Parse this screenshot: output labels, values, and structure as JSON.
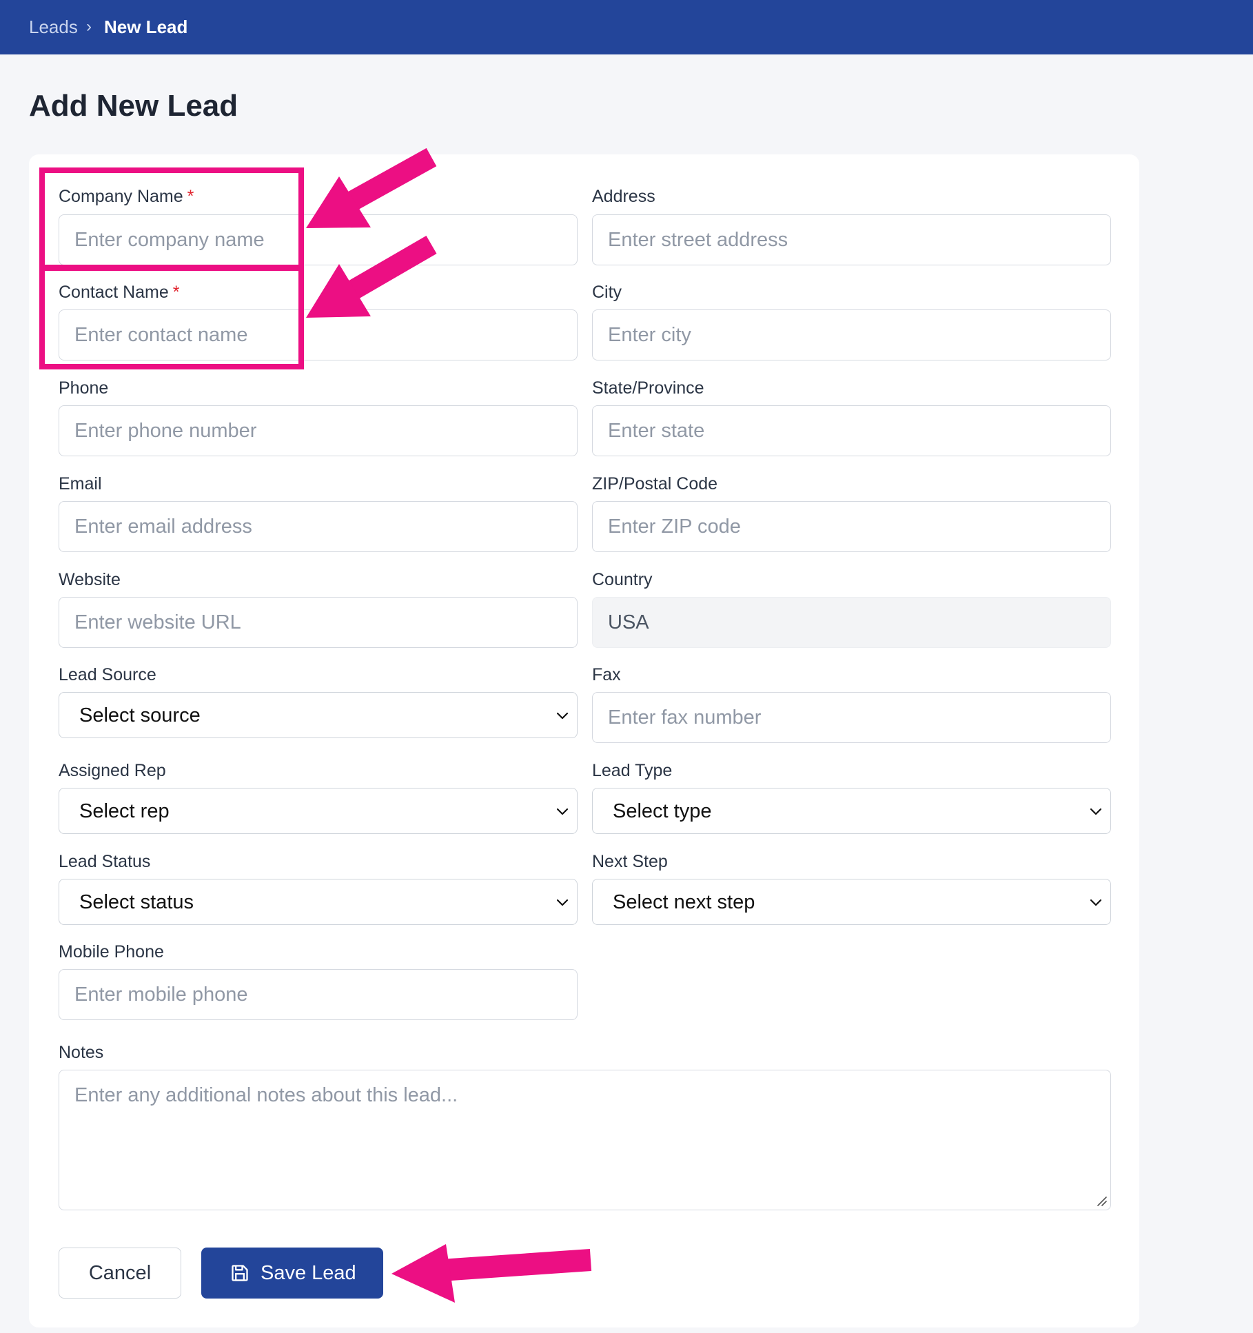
{
  "breadcrumb": {
    "parent": "Leads",
    "separator": "›",
    "current": "New Lead"
  },
  "page": {
    "title": "Add New Lead"
  },
  "form": {
    "required_marker": "*",
    "company_name": {
      "label": "Company Name",
      "placeholder": "Enter company name"
    },
    "contact_name": {
      "label": "Contact Name",
      "placeholder": "Enter contact name"
    },
    "phone": {
      "label": "Phone",
      "placeholder": "Enter phone number"
    },
    "email": {
      "label": "Email",
      "placeholder": "Enter email address"
    },
    "website": {
      "label": "Website",
      "placeholder": "Enter website URL"
    },
    "lead_source": {
      "label": "Lead Source",
      "value": "Select source"
    },
    "assigned_rep": {
      "label": "Assigned Rep",
      "value": "Select rep"
    },
    "lead_status": {
      "label": "Lead Status",
      "value": "Select status"
    },
    "mobile_phone": {
      "label": "Mobile Phone",
      "placeholder": "Enter mobile phone"
    },
    "address": {
      "label": "Address",
      "placeholder": "Enter street address"
    },
    "city": {
      "label": "City",
      "placeholder": "Enter city"
    },
    "state": {
      "label": "State/Province",
      "placeholder": "Enter state"
    },
    "zip": {
      "label": "ZIP/Postal Code",
      "placeholder": "Enter ZIP code"
    },
    "country": {
      "label": "Country",
      "value": "USA"
    },
    "fax": {
      "label": "Fax",
      "placeholder": "Enter fax number"
    },
    "lead_type": {
      "label": "Lead Type",
      "value": "Select type"
    },
    "next_step": {
      "label": "Next Step",
      "value": "Select next step"
    },
    "notes": {
      "label": "Notes",
      "placeholder": "Enter any additional notes about this lead..."
    }
  },
  "actions": {
    "cancel_label": "Cancel",
    "save_label": "Save Lead"
  },
  "icons": {
    "select_arrow": "chevron-down-icon",
    "save": "floppy-disk-icon",
    "resize": "resize-grip-icon"
  },
  "colors": {
    "header_bg": "#23459a",
    "primary_button": "#23459a",
    "required": "#e0242e",
    "annotation": "#ec0f83",
    "page_bg": "#f5f6f9"
  }
}
